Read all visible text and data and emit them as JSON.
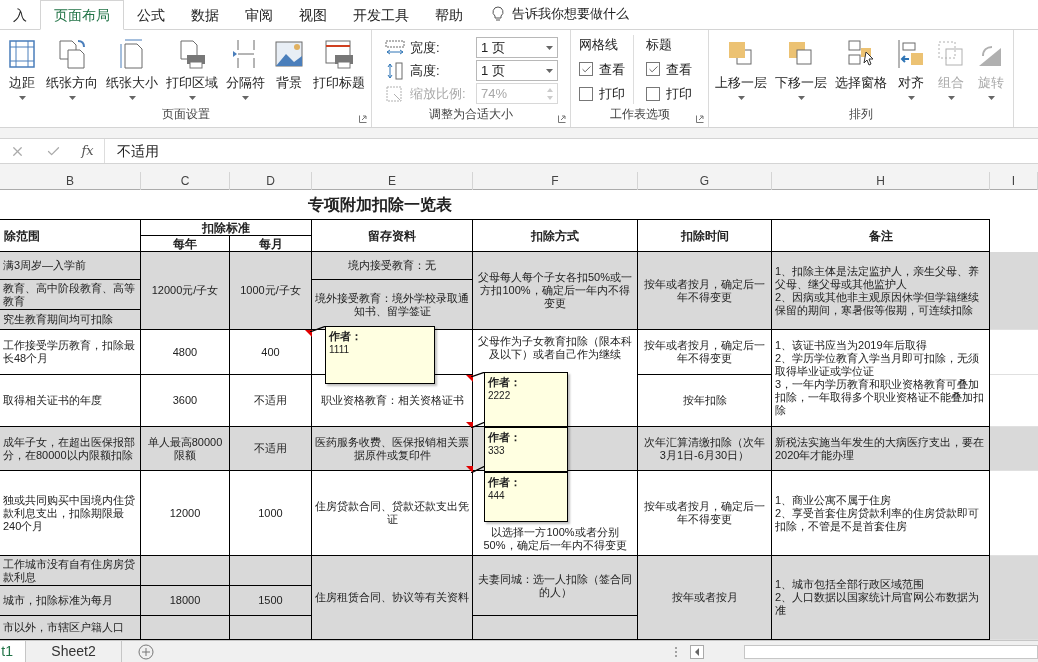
{
  "ribbon": {
    "tabs": [
      {
        "label": "入",
        "selected": false
      },
      {
        "label": "页面布局",
        "selected": true
      },
      {
        "label": "公式",
        "selected": false
      },
      {
        "label": "数据",
        "selected": false
      },
      {
        "label": "审阅",
        "selected": false
      },
      {
        "label": "视图",
        "selected": false
      },
      {
        "label": "开发工具",
        "selected": false
      },
      {
        "label": "帮助",
        "selected": false
      }
    ],
    "tell_me": "告诉我你想要做什么",
    "groups": [
      {
        "kind": "buttons",
        "title": "页面设置",
        "launcher": true,
        "buttons": [
          {
            "label": "边距",
            "dropdown": true,
            "disabled": false
          },
          {
            "label": "纸张方向",
            "dropdown": true,
            "disabled": false
          },
          {
            "label": "纸张大小",
            "dropdown": true,
            "disabled": false
          },
          {
            "label": "打印区域",
            "dropdown": true,
            "disabled": false
          },
          {
            "label": "分隔符",
            "dropdown": true,
            "disabled": false
          },
          {
            "label": "背景",
            "dropdown": false,
            "disabled": false
          },
          {
            "label": "打印标题",
            "dropdown": false,
            "disabled": false
          }
        ]
      },
      {
        "kind": "fit",
        "title": "调整为合适大小",
        "launcher": true,
        "fields": [
          {
            "label": "宽度:",
            "value": "1 页",
            "disabled": false
          },
          {
            "label": "高度:",
            "value": "1 页",
            "disabled": false
          },
          {
            "label": "缩放比例:",
            "value": "74%",
            "disabled": true
          }
        ]
      },
      {
        "kind": "options",
        "title": "工作表选项",
        "launcher": true,
        "columns": [
          {
            "title": "网格线",
            "options": [
              {
                "label": "查看",
                "checked": true
              },
              {
                "label": "打印",
                "checked": false
              }
            ]
          },
          {
            "title": "标题",
            "options": [
              {
                "label": "查看",
                "checked": true
              },
              {
                "label": "打印",
                "checked": false
              }
            ]
          }
        ]
      },
      {
        "kind": "buttons",
        "title": "排列",
        "buttons": [
          {
            "label": "上移一层",
            "dropdown": true,
            "disabled": false
          },
          {
            "label": "下移一层",
            "dropdown": true,
            "disabled": false
          },
          {
            "label": "选择窗格",
            "dropdown": false,
            "disabled": false
          },
          {
            "label": "对齐",
            "dropdown": true,
            "disabled": false
          },
          {
            "label": "组合",
            "dropdown": true,
            "disabled": true
          },
          {
            "label": "旋转",
            "dropdown": true,
            "disabled": true
          }
        ]
      }
    ]
  },
  "formula_bar": {
    "function_label": "fx",
    "value": "不适用"
  },
  "column_headers": [
    "B",
    "C",
    "D",
    "E",
    "F",
    "G",
    "H",
    "I"
  ],
  "sheet": {
    "title": "专项附加扣除一览表",
    "header": {
      "scope": "除范围",
      "standard": "扣除标准",
      "yearly": "每年",
      "monthly": "每月",
      "materials": "留存资料",
      "method": "扣除方式",
      "time": "扣除时间",
      "notes": "备注"
    },
    "rows": [
      {
        "shaded": true,
        "scope": [
          "满3周岁—入学前",
          "教育、高中阶段教育、高等教育",
          "究生教育期间均可扣除"
        ],
        "yearly": [
          "12000元/子女"
        ],
        "monthly": [
          "1000元/子女"
        ],
        "materials": [
          "境内接受教育：无",
          "境外接受教育：境外学校录取通知书、留学签证"
        ],
        "method": [
          "父母每人每个子女各扣50%或一方扣100%，确定后一年内不得变更"
        ],
        "time": [
          "按年或者按月，确定后一年不得变更"
        ],
        "notes": [
          "1、扣除主体是法定监护人，亲生父母、养父母、继父母或其他监护人\n2、因病或其他非主观原因休学但学籍继续保留的期间，寒暑假等假期，可连续扣除"
        ]
      },
      {
        "shaded": false,
        "scope": [
          "工作接受学历教育，扣除最长48个月"
        ],
        "yearly": [
          "4800"
        ],
        "monthly": [
          "400"
        ],
        "method": [
          "父母作为子女教育扣除（限本科及以下）或者自己作为继续"
        ],
        "time": [
          "按年或者按月，确定后一年不得变更"
        ],
        "notes": [
          "1、该证书应当为2019年后取得\n2、学历学位教育入学当月即可扣除，无须取得毕业证或学位证\n3，一年内学历教育和职业资格教育可叠加扣除，一年取得多个职业资格证不能叠加扣除"
        ]
      },
      {
        "shaded": false,
        "scope": [
          "取得相关证书的年度"
        ],
        "yearly": [
          "3600"
        ],
        "monthly": [
          "不适用"
        ],
        "materials": [
          "职业资格教育：相关资格证书"
        ],
        "time": [
          "按年扣除"
        ]
      },
      {
        "shaded": true,
        "scope": [
          "成年子女，在超出医保报部分，在80000以内限额扣除"
        ],
        "yearly": [
          "单人最高80000限额"
        ],
        "monthly": [
          "不适用"
        ],
        "materials": [
          "医药服务收费、医保报销相关票据原件或复印件"
        ],
        "time": [
          "次年汇算清缴扣除（次年3月1日-6月30日）"
        ],
        "notes": [
          "新税法实施当年发生的大病医疗支出，要在2020年才能办理"
        ]
      },
      {
        "shaded": false,
        "scope": [
          "独或共同购买中国境内住贷款利息支出，扣除期限最240个月"
        ],
        "yearly": [
          "12000"
        ],
        "monthly": [
          "1000"
        ],
        "materials": [
          "住房贷款合同、贷款还款支出凭证"
        ],
        "method": [
          "以选择一方100%或者分别50%，确定后一年内不得变更"
        ],
        "time": [
          "按年或者按月，确定后一年不得变更"
        ],
        "notes": [
          "1、商业公寓不属于住房\n2、享受首套住房贷款利率的住房贷款即可扣除，不管是不是首套住房"
        ]
      },
      {
        "shaded": true,
        "scope": [
          "工作城市没有自有住房房贷款利息",
          "城市，扣除标准为每月",
          "市以外，市辖区户籍人口"
        ],
        "yearly": [
          "18000"
        ],
        "monthly": [
          "1500"
        ],
        "materials": [
          "住房租赁合同、协议等有关资料"
        ],
        "method": [
          "夫妻同城：选一人扣除（签合同的人）"
        ],
        "time": [
          "按年或者按月"
        ],
        "notes": [
          "1、城市包括全部行政区域范围\n2、人口数据以国家统计局官网公布数据为准"
        ]
      }
    ]
  },
  "comments": [
    {
      "author": "作者：",
      "text": "1111"
    },
    {
      "author": "作者：",
      "text": "2222"
    },
    {
      "author": "作者：",
      "text": "333"
    },
    {
      "author": "作者：",
      "text": "444"
    }
  ],
  "sheet_tabs": [
    {
      "label": "t1",
      "selected": true
    },
    {
      "label": "Sheet2",
      "selected": false
    }
  ]
}
